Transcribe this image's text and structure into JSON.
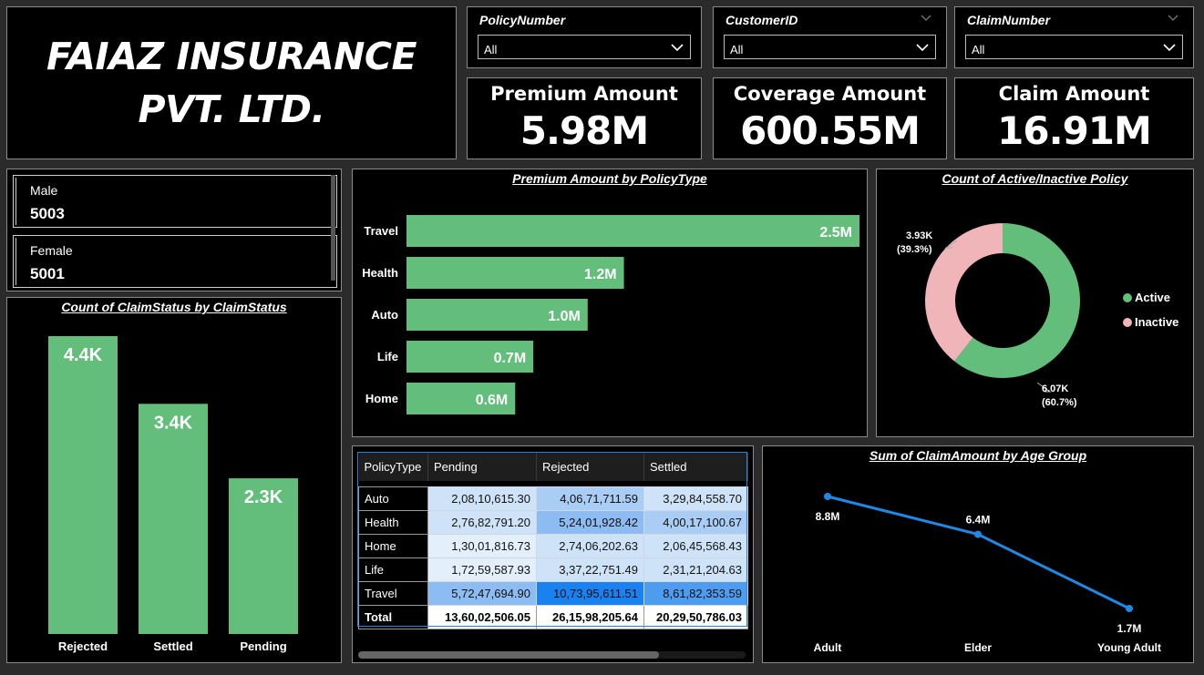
{
  "title": {
    "line1": "FAIAZ INSURANCE",
    "line2": "PVT. LTD."
  },
  "slicers": [
    {
      "label": "PolicyNumber",
      "value": "All"
    },
    {
      "label": "CustomerID",
      "value": "All"
    },
    {
      "label": "ClaimNumber",
      "value": "All"
    }
  ],
  "cards": [
    {
      "label": "Premium Amount",
      "value": "5.98M"
    },
    {
      "label": "Coverage Amount",
      "value": "600.55M"
    },
    {
      "label": "Claim Amount",
      "value": "16.91M"
    }
  ],
  "gender": [
    {
      "label": "Male",
      "value": "5003"
    },
    {
      "label": "Female",
      "value": "5001"
    }
  ],
  "colors": {
    "bar": "#63be7b",
    "inactive": "#f0b5b8",
    "line": "#1e88e5"
  },
  "chart_data": [
    {
      "type": "bar",
      "title": "Count of ClaimStatus by ClaimStatus",
      "categories": [
        "Rejected",
        "Settled",
        "Pending"
      ],
      "values": [
        4400,
        3400,
        2300
      ],
      "labels": [
        "4.4K",
        "3.4K",
        "2.3K"
      ],
      "orientation": "vertical"
    },
    {
      "type": "bar",
      "title": "Premium Amount by PolicyType",
      "categories": [
        "Travel",
        "Health",
        "Auto",
        "Life",
        "Home"
      ],
      "values": [
        2.5,
        1.2,
        1.0,
        0.7,
        0.6
      ],
      "labels": [
        "2.5M",
        "1.2M",
        "1.0M",
        "0.7M",
        "0.6M"
      ],
      "orientation": "horizontal"
    },
    {
      "type": "pie",
      "title": "Count of Active/Inactive Policy",
      "categories": [
        "Active",
        "Inactive"
      ],
      "values": [
        6070,
        3930
      ],
      "labels": [
        "6.07K",
        "3.93K"
      ],
      "percent": [
        "(60.7%)",
        "(39.3%)"
      ],
      "legend": "right"
    },
    {
      "type": "table",
      "columns": [
        "PolicyType",
        "Pending",
        "Rejected",
        "Settled"
      ],
      "rows": [
        {
          "type": "Auto",
          "cells": [
            "2,08,10,615.30",
            "4,06,71,711.59",
            "3,29,84,558.70"
          ],
          "shade": [
            1,
            2,
            1
          ]
        },
        {
          "type": "Health",
          "cells": [
            "2,76,82,791.20",
            "5,24,01,928.42",
            "4,00,17,100.67"
          ],
          "shade": [
            1,
            3,
            2
          ]
        },
        {
          "type": "Home",
          "cells": [
            "1,30,01,816.73",
            "2,74,06,202.63",
            "2,06,45,568.43"
          ],
          "shade": [
            0,
            1,
            1
          ]
        },
        {
          "type": "Life",
          "cells": [
            "1,72,59,587.93",
            "3,37,22,751.49",
            "2,31,21,204.63"
          ],
          "shade": [
            0,
            1,
            1
          ]
        },
        {
          "type": "Travel",
          "cells": [
            "5,72,47,694.90",
            "10,73,95,611.51",
            "8,61,82,353.59"
          ],
          "shade": [
            3,
            5,
            4
          ]
        }
      ],
      "total": {
        "label": "Total",
        "cells": [
          "13,60,02,506.05",
          "26,15,98,205.64",
          "20,29,50,786.03"
        ]
      }
    },
    {
      "type": "line",
      "title": "Sum of ClaimAmount by Age Group",
      "categories": [
        "Adult",
        "Elder",
        "Young Adult"
      ],
      "values": [
        8.8,
        6.4,
        1.7
      ],
      "labels": [
        "8.8M",
        "6.4M",
        "1.7M"
      ]
    }
  ]
}
